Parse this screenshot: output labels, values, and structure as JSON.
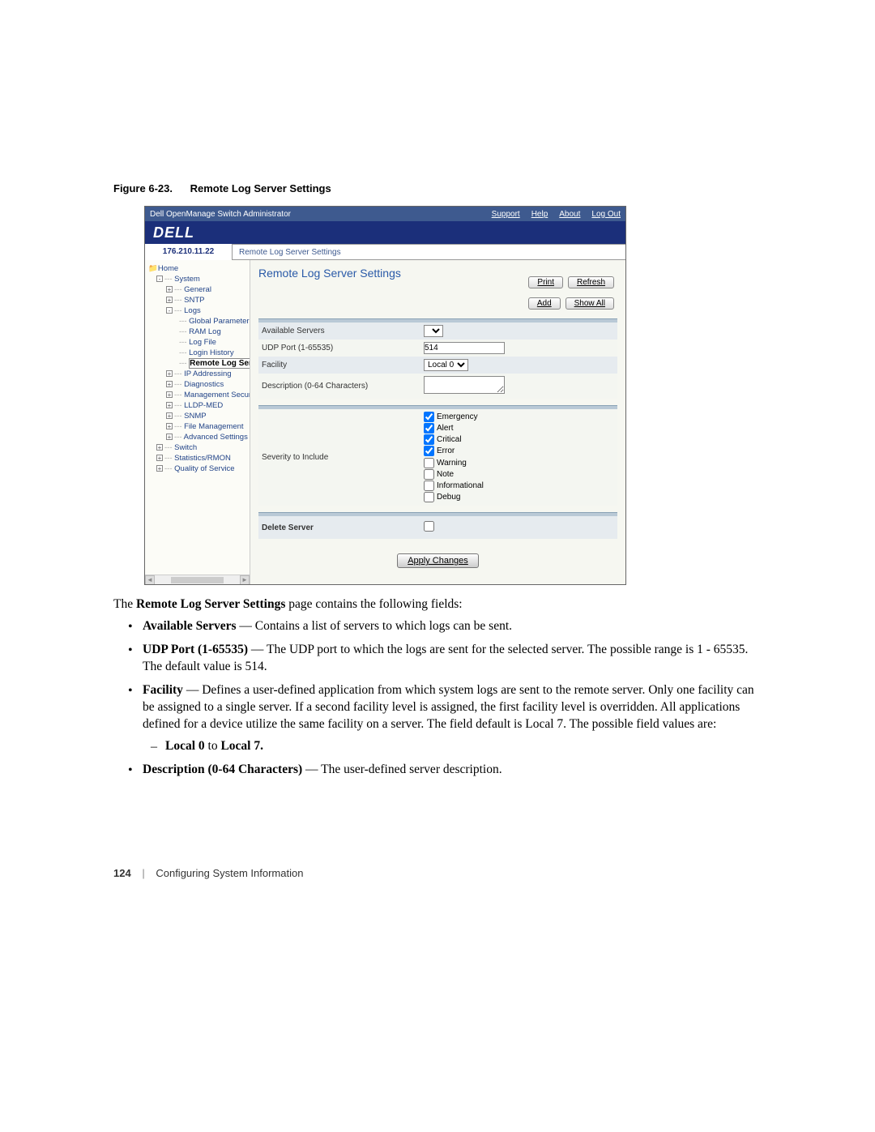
{
  "figure": {
    "num": "Figure 6-23.",
    "title": "Remote Log Server Settings"
  },
  "titlebar": {
    "app": "Dell OpenManage Switch Administrator",
    "links": [
      "Support",
      "Help",
      "About",
      "Log Out"
    ]
  },
  "brand": "DELL",
  "ip": "176.210.11.22",
  "breadcrumb": "Remote Log Server Settings",
  "tree": {
    "home": "Home",
    "system": "System",
    "general": "General",
    "sntp": "SNTP",
    "logs": "Logs",
    "global_params": "Global Parameters",
    "ram_log": "RAM Log",
    "log_file": "Log File",
    "login_history": "Login History",
    "remote_log_serve": "Remote Log Serve",
    "ip_addressing": "IP Addressing",
    "diagnostics": "Diagnostics",
    "mgmt_security": "Management Security",
    "lldp_med": "LLDP-MED",
    "snmp": "SNMP",
    "file_mgmt": "File Management",
    "adv_settings": "Advanced Settings",
    "switch": "Switch",
    "stats_rmon": "Statistics/RMON",
    "qos": "Quality of Service"
  },
  "page_title": "Remote Log Server Settings",
  "buttons": {
    "print": "Print",
    "refresh": "Refresh",
    "add": "Add",
    "show_all": "Show All",
    "apply": "Apply Changes"
  },
  "form": {
    "available_servers": "Available Servers",
    "udp_port": "UDP Port (1-65535)",
    "udp_port_value": "514",
    "facility": "Facility",
    "facility_value": "Local 0",
    "description": "Description (0-64 Characters)",
    "severity": "Severity to Include",
    "delete_server": "Delete Server"
  },
  "severity": {
    "emergency": "Emergency",
    "alert": "Alert",
    "critical": "Critical",
    "error": "Error",
    "warning": "Warning",
    "note": "Note",
    "informational": "Informational",
    "debug": "Debug"
  },
  "text": {
    "intro_a": "The ",
    "intro_b": "Remote Log Server Settings",
    "intro_c": " page contains the following fields:",
    "b1_t": "Available Servers",
    "b1_d": " — Contains a list of servers to which logs can be sent.",
    "b2_t": "UDP Port (1-65535)",
    "b2_d": " — The UDP port to which the logs are sent for the selected server. The possible range is 1 - 65535. The default value is 514.",
    "b3_t": "Facility",
    "b3_d": " — Defines a user-defined application from which system logs are sent to the remote server. Only one facility can be assigned to a single server. If a second facility level is assigned, the first facility level is overridden. All applications defined for a device utilize the same facility on a server. The field default is Local 7. The possible field values are:",
    "b3_s1a": "Local 0",
    "b3_s1b": " to ",
    "b3_s1c": "Local 7.",
    "b4_t": "Description (0-64 Characters)",
    "b4_d": " — The user-defined server description."
  },
  "footer": {
    "page": "124",
    "section": "Configuring System Information"
  }
}
